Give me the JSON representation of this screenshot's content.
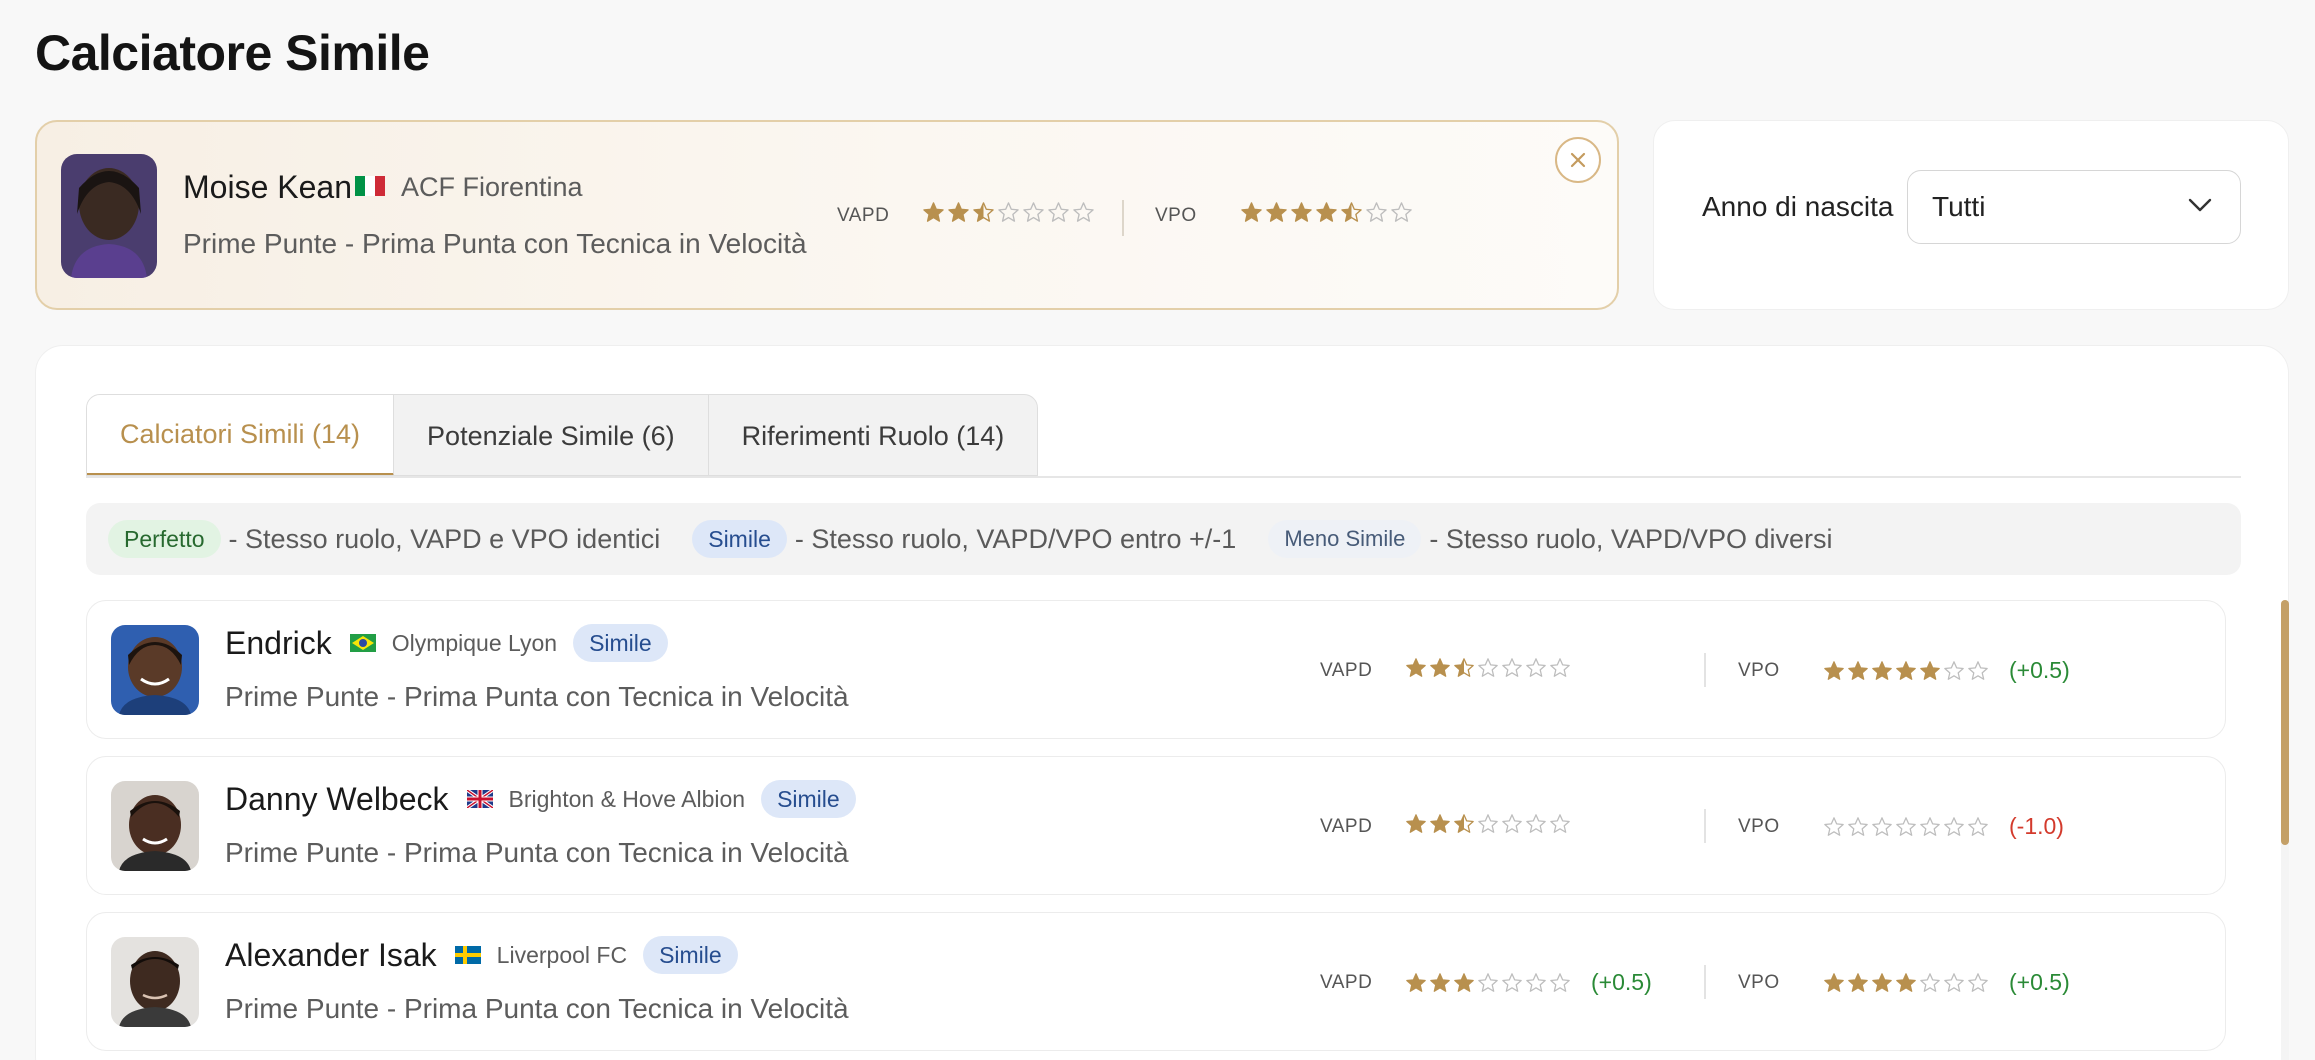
{
  "page": {
    "title": "Calciatore Simile"
  },
  "selected": {
    "name": "Moise Kean",
    "flag": "italy-flag-icon",
    "team": "ACF Fiorentina",
    "role": "Prime Punte - Prima Punta con Tecnica in Velocità",
    "vapd_label": "VAPD",
    "vapd_rating": 2.5,
    "vpo_label": "VPO",
    "vpo_rating": 4.5,
    "max_stars": 7
  },
  "filter": {
    "label": "Anno di nascita",
    "value": "Tutti"
  },
  "tabs": [
    {
      "label": "Calciatori Simili (14)",
      "active": true
    },
    {
      "label": "Potenziale Simile (6)",
      "active": false
    },
    {
      "label": "Riferimenti Ruolo (14)",
      "active": false
    }
  ],
  "legend": [
    {
      "badge": "Perfetto",
      "text": "- Stesso ruolo, VAPD e VPO identici"
    },
    {
      "badge": "Simile",
      "text": "- Stesso ruolo, VAPD/VPO entro +/-1"
    },
    {
      "badge": "Meno Simile",
      "text": "- Stesso ruolo, VAPD/VPO diversi"
    }
  ],
  "players": [
    {
      "name": "Endrick",
      "flag": "brazil-flag-icon",
      "team": "Olympique Lyon",
      "badge": "Simile",
      "role": "Prime Punte - Prima Punta con Tecnica in Velocità",
      "vapd_label": "VAPD",
      "vapd_rating": 2.5,
      "vapd_delta": "",
      "vpo_label": "VPO",
      "vpo_rating": 5,
      "vpo_delta": "(+0.5)"
    },
    {
      "name": "Danny Welbeck",
      "flag": "uk-flag-icon",
      "team": "Brighton & Hove Albion",
      "badge": "Simile",
      "role": "Prime Punte - Prima Punta con Tecnica in Velocità",
      "vapd_label": "VAPD",
      "vapd_rating": 2.5,
      "vapd_delta": "",
      "vpo_label": "VPO",
      "vpo_rating": 0,
      "vpo_delta": "(-1.0)"
    },
    {
      "name": "Alexander Isak",
      "flag": "sweden-flag-icon",
      "team": "Liverpool FC",
      "badge": "Simile",
      "role": "Prime Punte - Prima Punta con Tecnica in Velocità",
      "vapd_label": "VAPD",
      "vapd_rating": 3,
      "vapd_delta": "(+0.5)",
      "vpo_label": "VPO",
      "vpo_rating": 4,
      "vpo_delta": "(+0.5)"
    }
  ],
  "colors": {
    "accent": "#b8904e",
    "star": "#b8904e",
    "positive": "#2a8a36",
    "negative": "#d33a2c"
  }
}
